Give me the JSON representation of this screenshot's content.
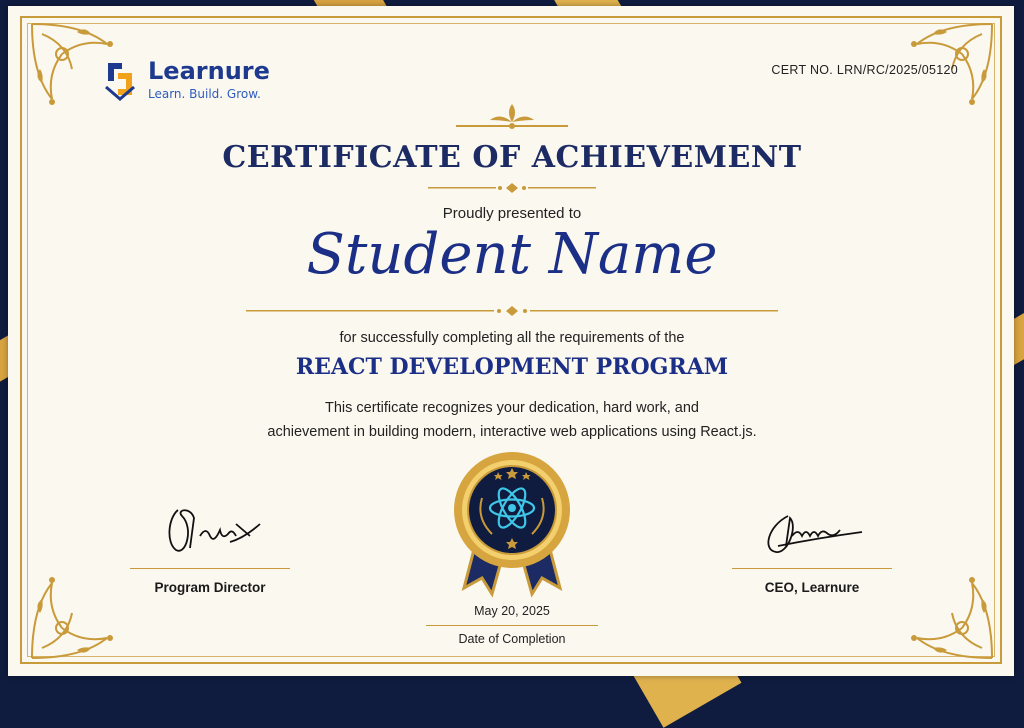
{
  "logo": {
    "name": "Learnure",
    "tagline": "Learn. Build. Grow."
  },
  "certificate_number": "CERT NO. LRN/RC/2025/05120",
  "title": "CERTIFICATE OF ACHIEVEMENT",
  "presented_to": "Proudly presented to",
  "recipient_name": "Student Name",
  "completion_text": "for successfully completing all the requirements of the",
  "program_name": "REACT DEVELOPMENT PROGRAM",
  "description_line1": "This certificate recognizes your dedication, hard work, and",
  "description_line2": "achievement in building modern, interactive web applications using React.js.",
  "signatures": {
    "left_title": "Program Director",
    "right_title": "CEO, Learnure"
  },
  "completion": {
    "date": "May 20, 2025",
    "label": "Date of Completion"
  },
  "colors": {
    "navy": "#1c2b63",
    "blue": "#1c2f87",
    "gold": "#c99a3a",
    "paper": "#fbf8f0"
  }
}
